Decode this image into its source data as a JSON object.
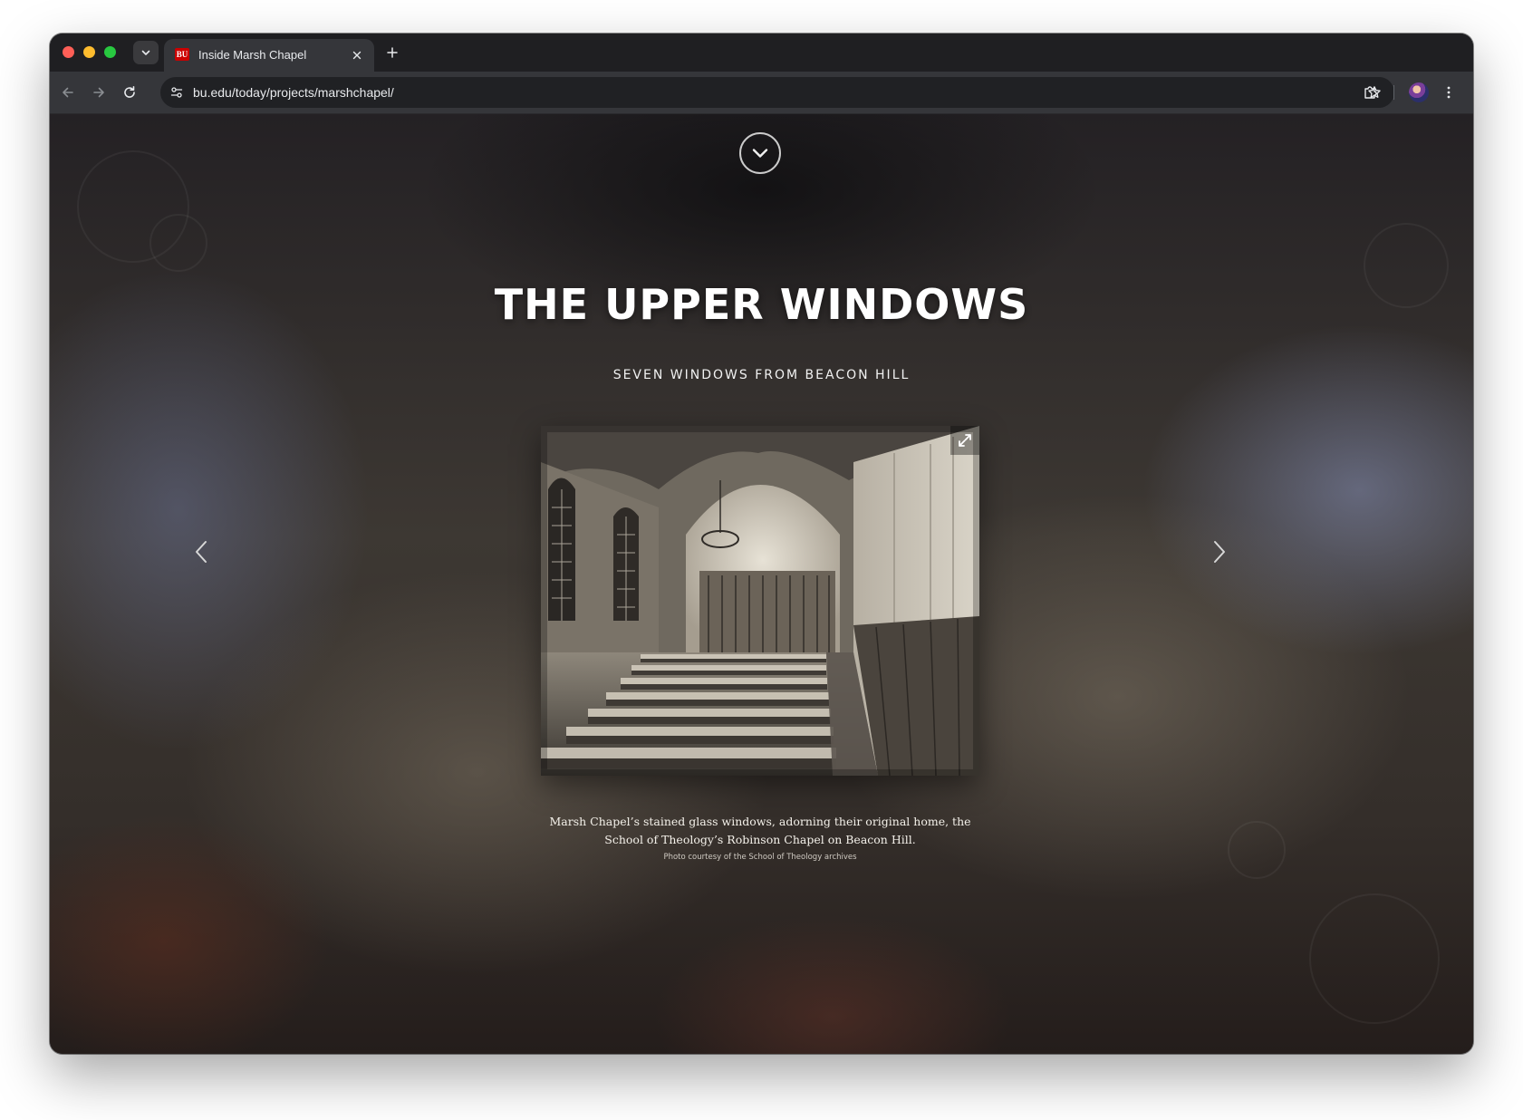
{
  "browser": {
    "tab": {
      "favicon_text": "BU",
      "title": "Inside Marsh Chapel"
    },
    "address_bar": {
      "url": "bu.edu/today/projects/marshchapel/"
    },
    "icons": {
      "tab_search": "chevron-down-icon",
      "close_tab": "close-icon",
      "new_tab": "plus-icon",
      "back": "arrow-left-icon",
      "forward": "arrow-right-icon",
      "reload": "reload-icon",
      "site_info": "tune-icon",
      "bookmark": "star-icon",
      "extensions": "puzzle-icon",
      "menu": "kebab-menu-icon"
    },
    "colors": {
      "titlebar": "#1f1f22",
      "toolbar": "#35363a",
      "omnibox": "#202124",
      "close_dot": "#ff5f57",
      "minimize_dot": "#febc2e",
      "zoom_dot": "#28c840"
    }
  },
  "page": {
    "section_title": "THE UPPER WINDOWS",
    "section_subtitle": "SEVEN WINDOWS FROM BEACON HILL",
    "slide": {
      "image_subject": "black-and-white photograph of chapel interior with pews and stained glass windows",
      "caption": "Marsh Chapel’s stained glass windows, adorning their original home, the School of Theology’s Robinson Chapel on Beacon Hill.",
      "credit": "Photo courtesy of the School of Theology archives"
    },
    "icons": {
      "scroll_down": "chevron-down-circle-icon",
      "previous": "chevron-left-icon",
      "next": "chevron-right-icon",
      "fullscreen": "expand-icon"
    }
  }
}
